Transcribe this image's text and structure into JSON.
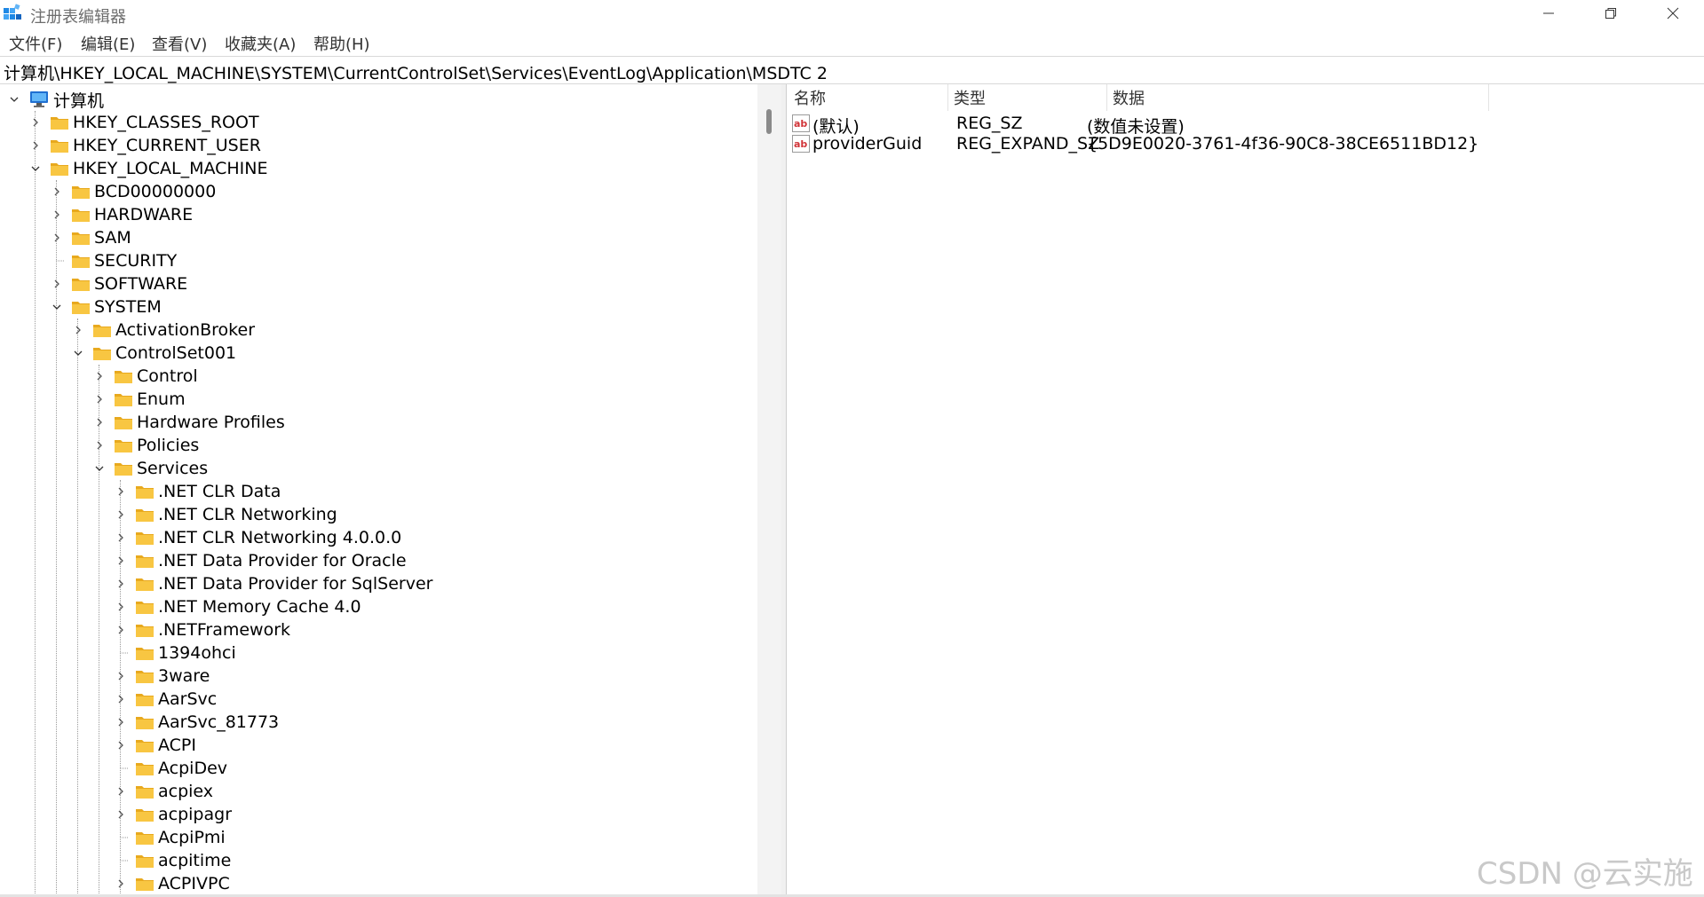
{
  "window": {
    "title": "注册表编辑器",
    "icon": "registry-editor-icon"
  },
  "menu": [
    "文件(F)",
    "编辑(E)",
    "查看(V)",
    "收藏夹(A)",
    "帮助(H)"
  ],
  "address": "计算机\\HKEY_LOCAL_MACHINE\\SYSTEM\\CurrentControlSet\\Services\\EventLog\\Application\\MSDTC 2",
  "tree": [
    {
      "label": "计算机",
      "level": 0,
      "state": "expanded",
      "icon": "computer-icon"
    },
    {
      "label": "HKEY_CLASSES_ROOT",
      "level": 1,
      "state": "collapsed"
    },
    {
      "label": "HKEY_CURRENT_USER",
      "level": 1,
      "state": "collapsed"
    },
    {
      "label": "HKEY_LOCAL_MACHINE",
      "level": 1,
      "state": "expanded"
    },
    {
      "label": "BCD00000000",
      "level": 2,
      "state": "collapsed"
    },
    {
      "label": "HARDWARE",
      "level": 2,
      "state": "collapsed"
    },
    {
      "label": "SAM",
      "level": 2,
      "state": "collapsed"
    },
    {
      "label": "SECURITY",
      "level": 2,
      "state": "leaf"
    },
    {
      "label": "SOFTWARE",
      "level": 2,
      "state": "collapsed"
    },
    {
      "label": "SYSTEM",
      "level": 2,
      "state": "expanded"
    },
    {
      "label": "ActivationBroker",
      "level": 3,
      "state": "collapsed"
    },
    {
      "label": "ControlSet001",
      "level": 3,
      "state": "expanded"
    },
    {
      "label": "Control",
      "level": 4,
      "state": "collapsed"
    },
    {
      "label": "Enum",
      "level": 4,
      "state": "collapsed"
    },
    {
      "label": "Hardware Profiles",
      "level": 4,
      "state": "collapsed"
    },
    {
      "label": "Policies",
      "level": 4,
      "state": "collapsed"
    },
    {
      "label": "Services",
      "level": 4,
      "state": "expanded"
    },
    {
      "label": ".NET CLR Data",
      "level": 5,
      "state": "collapsed"
    },
    {
      "label": ".NET CLR Networking",
      "level": 5,
      "state": "collapsed"
    },
    {
      "label": ".NET CLR Networking 4.0.0.0",
      "level": 5,
      "state": "collapsed"
    },
    {
      "label": ".NET Data Provider for Oracle",
      "level": 5,
      "state": "collapsed"
    },
    {
      "label": ".NET Data Provider for SqlServer",
      "level": 5,
      "state": "collapsed"
    },
    {
      "label": ".NET Memory Cache 4.0",
      "level": 5,
      "state": "collapsed"
    },
    {
      "label": ".NETFramework",
      "level": 5,
      "state": "collapsed"
    },
    {
      "label": "1394ohci",
      "level": 5,
      "state": "leaf"
    },
    {
      "label": "3ware",
      "level": 5,
      "state": "collapsed"
    },
    {
      "label": "AarSvc",
      "level": 5,
      "state": "collapsed"
    },
    {
      "label": "AarSvc_81773",
      "level": 5,
      "state": "collapsed"
    },
    {
      "label": "ACPI",
      "level": 5,
      "state": "collapsed"
    },
    {
      "label": "AcpiDev",
      "level": 5,
      "state": "leaf"
    },
    {
      "label": "acpiex",
      "level": 5,
      "state": "collapsed"
    },
    {
      "label": "acpipagr",
      "level": 5,
      "state": "collapsed"
    },
    {
      "label": "AcpiPmi",
      "level": 5,
      "state": "leaf"
    },
    {
      "label": "acpitime",
      "level": 5,
      "state": "leaf"
    },
    {
      "label": "ACPIVPC",
      "level": 5,
      "state": "collapsed"
    }
  ],
  "columns": {
    "name": "名称",
    "type": "类型",
    "data": "数据"
  },
  "values": [
    {
      "name": "(默认)",
      "type": "REG_SZ",
      "data": "(数值未设置)",
      "icon": "string-value-icon"
    },
    {
      "name": "providerGuid",
      "type": "REG_EXPAND_SZ",
      "data": "{5D9E0020-3761-4f36-90C8-38CE6511BD12}",
      "icon": "string-value-icon"
    }
  ],
  "watermark": "CSDN @云实施",
  "colors": {
    "folder": "#f8c642",
    "folder_dark": "#e8a91e",
    "icon_red": "#d13438"
  }
}
